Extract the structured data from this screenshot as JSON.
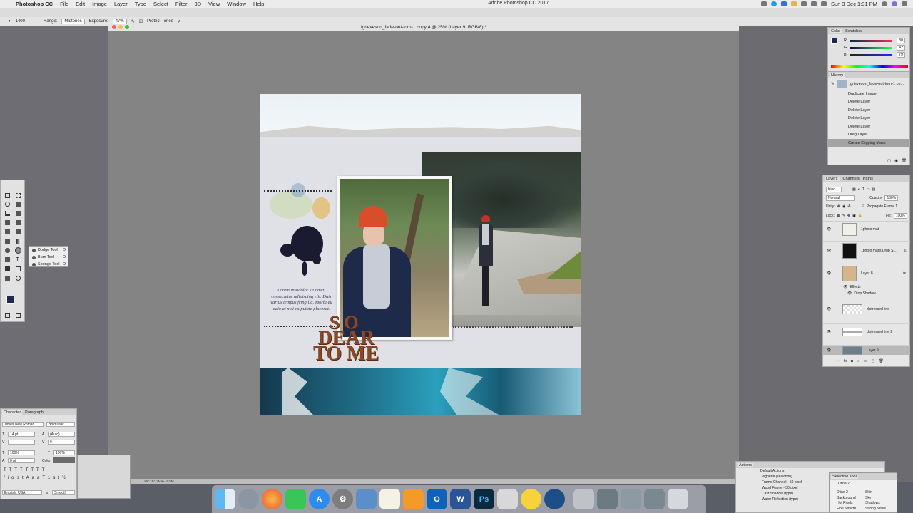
{
  "menubar": {
    "app_name": "Photoshop CC",
    "items": [
      "File",
      "Edit",
      "Image",
      "Layer",
      "Type",
      "Select",
      "Filter",
      "3D",
      "View",
      "Window",
      "Help"
    ],
    "window_title": "Adobe Photoshop CC 2017",
    "clock": "Sun 3 Dec  1:31 PM"
  },
  "options": {
    "brush_size": "1400",
    "range_label": "Range:",
    "range_value": "Midtones",
    "exposure_label": "Exposure:",
    "exposure_value": "47%",
    "protect_tones": "Protect Tones"
  },
  "document": {
    "tab_title": "lgrieveson_fade-out-torn-1 copy 4 @ 25% (Layer 9, RGB/8) *",
    "doc_size": "Doc: 37.1M/472.0M",
    "lorem": "Lorem ipsudolor sit amet, consectetur adipiscing elit. Duis varius tempus fringilla. Morbi eu odio at nisi vulputate placerat.",
    "title_l1": "SO",
    "title_l2": "DEAR",
    "title_l3": "TO ME"
  },
  "flyout": [
    {
      "label": "Dodge Tool",
      "key": "O"
    },
    {
      "label": "Burn Tool",
      "key": "O"
    },
    {
      "label": "Sponge Tool",
      "key": "O"
    }
  ],
  "character": {
    "tabs": [
      "Character",
      "Paragraph"
    ],
    "font": "Times New Roman",
    "style": "Bold Italic",
    "size": "14 pt",
    "leading": "(Auto)",
    "tracking": "0",
    "vscale": "100%",
    "hscale": "100%",
    "baseline": "0 pt",
    "color_label": "Color:",
    "language": "English: USA",
    "antialias": "Smooth",
    "aa_label": "a"
  },
  "color_panel": {
    "tabs": [
      "Color",
      "Swatches"
    ],
    "r_label": "R",
    "g_label": "G",
    "b_label": "B",
    "r": "30",
    "g": "42",
    "b": "79",
    "swatch_color": "#1e2a4f"
  },
  "history": {
    "title": "History",
    "snapshot": "lgrieveson_fade-out-torn-1 co...",
    "items": [
      "Duplicate Image",
      "Delete Layer",
      "Delete Layer",
      "Delete Layer",
      "Delete Layer",
      "Drag Layer",
      "Create Clipping Mask"
    ],
    "selected_index": 6
  },
  "layers": {
    "tabs": [
      "Layers",
      "Channels",
      "Paths"
    ],
    "kind": "Kind",
    "blend": "Normal",
    "opacity_label": "Opacity:",
    "opacity": "100%",
    "unify": "Unify:",
    "propagate": "Propagate Frame 1",
    "lock": "Lock:",
    "fill_label": "Fill:",
    "fill": "100%",
    "rows": [
      {
        "name": "1photo mat"
      },
      {
        "name": "1photo mat's Drop S..."
      },
      {
        "name": "Layer 8"
      },
      {
        "name": "Effects"
      },
      {
        "name": "Drop Shadow"
      },
      {
        "name": "distressed line"
      },
      {
        "name": "distressed line 2"
      },
      {
        "name": "Layer 9"
      }
    ]
  },
  "actions": {
    "title": "Actions",
    "items": [
      "Default Actions",
      "Vignette (selection)",
      "Frame Channel - 50 pixel",
      "Wood Frame - 50 pixel",
      "Cast Shadow (type)",
      "Water Reflection (type)"
    ]
  },
  "selective_tool": {
    "title": "Selective Tool",
    "set": "Dfine 2",
    "col1": [
      "Dfine 2",
      "Background",
      "Hot Pixels",
      "Fine Structu..."
    ],
    "col2": [
      "Skin",
      "Sky",
      "Shadows",
      "Strong Noise"
    ]
  },
  "dock_apps": [
    "Finder",
    "Launchpad",
    "Firefox",
    "Messages",
    "App Store",
    "System Preferences",
    "Preview",
    "TextEdit",
    "Pages",
    "Outlook",
    "Word",
    "Ps",
    "Stickies",
    "Cyberduck",
    "QuickTime",
    "Screenshots",
    "Finder window",
    "Photoshop doc 1",
    "Photoshop doc 2",
    "Trash"
  ]
}
